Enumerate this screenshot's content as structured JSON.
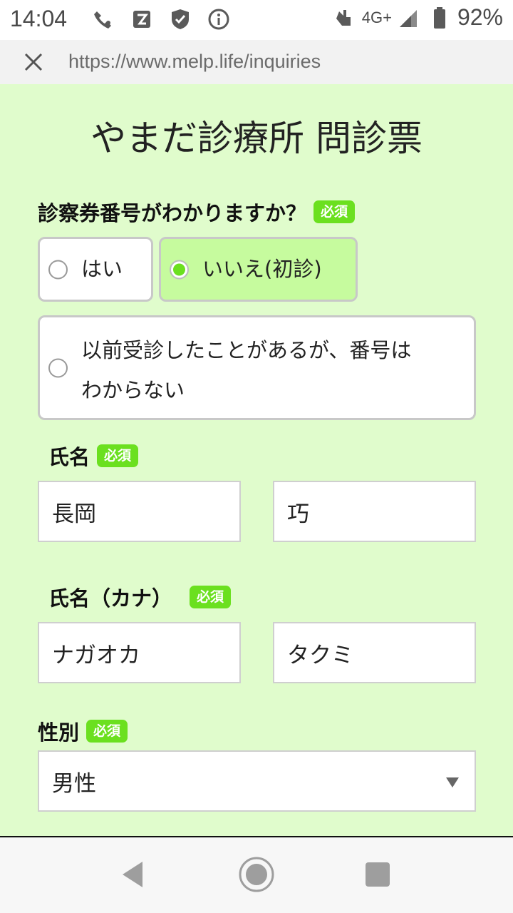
{
  "status_bar": {
    "time": "14:04",
    "network": "4G+",
    "battery": "92%",
    "icons": [
      "wifi-calling-icon",
      "app-icon",
      "shield-icon",
      "info-icon",
      "hand-icon",
      "signal-icon",
      "battery-icon"
    ]
  },
  "url_bar": {
    "url": "https://www.melp.life/inquiries",
    "close_icon": "close-icon"
  },
  "page": {
    "title": "やまだ診療所 問診票",
    "required_badge": "必須",
    "q_card_number": {
      "label": "診察券番号がわかりますか？",
      "options": [
        {
          "label": "はい",
          "selected": false
        },
        {
          "label": "いいえ(初診)",
          "selected": true
        },
        {
          "label": "以前受診したことがあるが、番号は わからない",
          "line1": "以前受診したことがあるが、番号は",
          "line2": "わからない",
          "selected": false
        }
      ]
    },
    "name": {
      "label": "氏名",
      "last": "長岡",
      "first": "巧"
    },
    "name_kana": {
      "label": "氏名（カナ）",
      "last": "ナガオカ",
      "first": "タクミ"
    },
    "gender": {
      "label": "性別",
      "selected": "男性"
    }
  },
  "colors": {
    "page_bg": "#e0fccc",
    "accent": "#6be01f",
    "selected_option_bg": "#c6fb9e"
  },
  "nav_bar": {
    "icons": [
      "back-icon",
      "home-icon",
      "recents-icon"
    ]
  }
}
